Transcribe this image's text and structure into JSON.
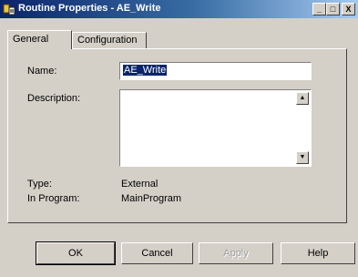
{
  "window": {
    "title": "Routine Properties - AE_Write",
    "minimize_glyph": "_",
    "maximize_glyph": "□",
    "close_glyph": "X"
  },
  "tabs": [
    {
      "label": "General",
      "active": true
    },
    {
      "label": "Configuration",
      "active": false
    }
  ],
  "form": {
    "name_label": "Name:",
    "name_value": "AE_Write",
    "description_label": "Description:",
    "description_value": "",
    "type_label": "Type:",
    "type_value": "External",
    "program_label": "In Program:",
    "program_value": "MainProgram"
  },
  "buttons": {
    "ok": "OK",
    "cancel": "Cancel",
    "apply": "Apply",
    "help": "Help"
  },
  "icons": {
    "app": "routine-icon",
    "scroll_up": "▲",
    "scroll_down": "▼"
  }
}
